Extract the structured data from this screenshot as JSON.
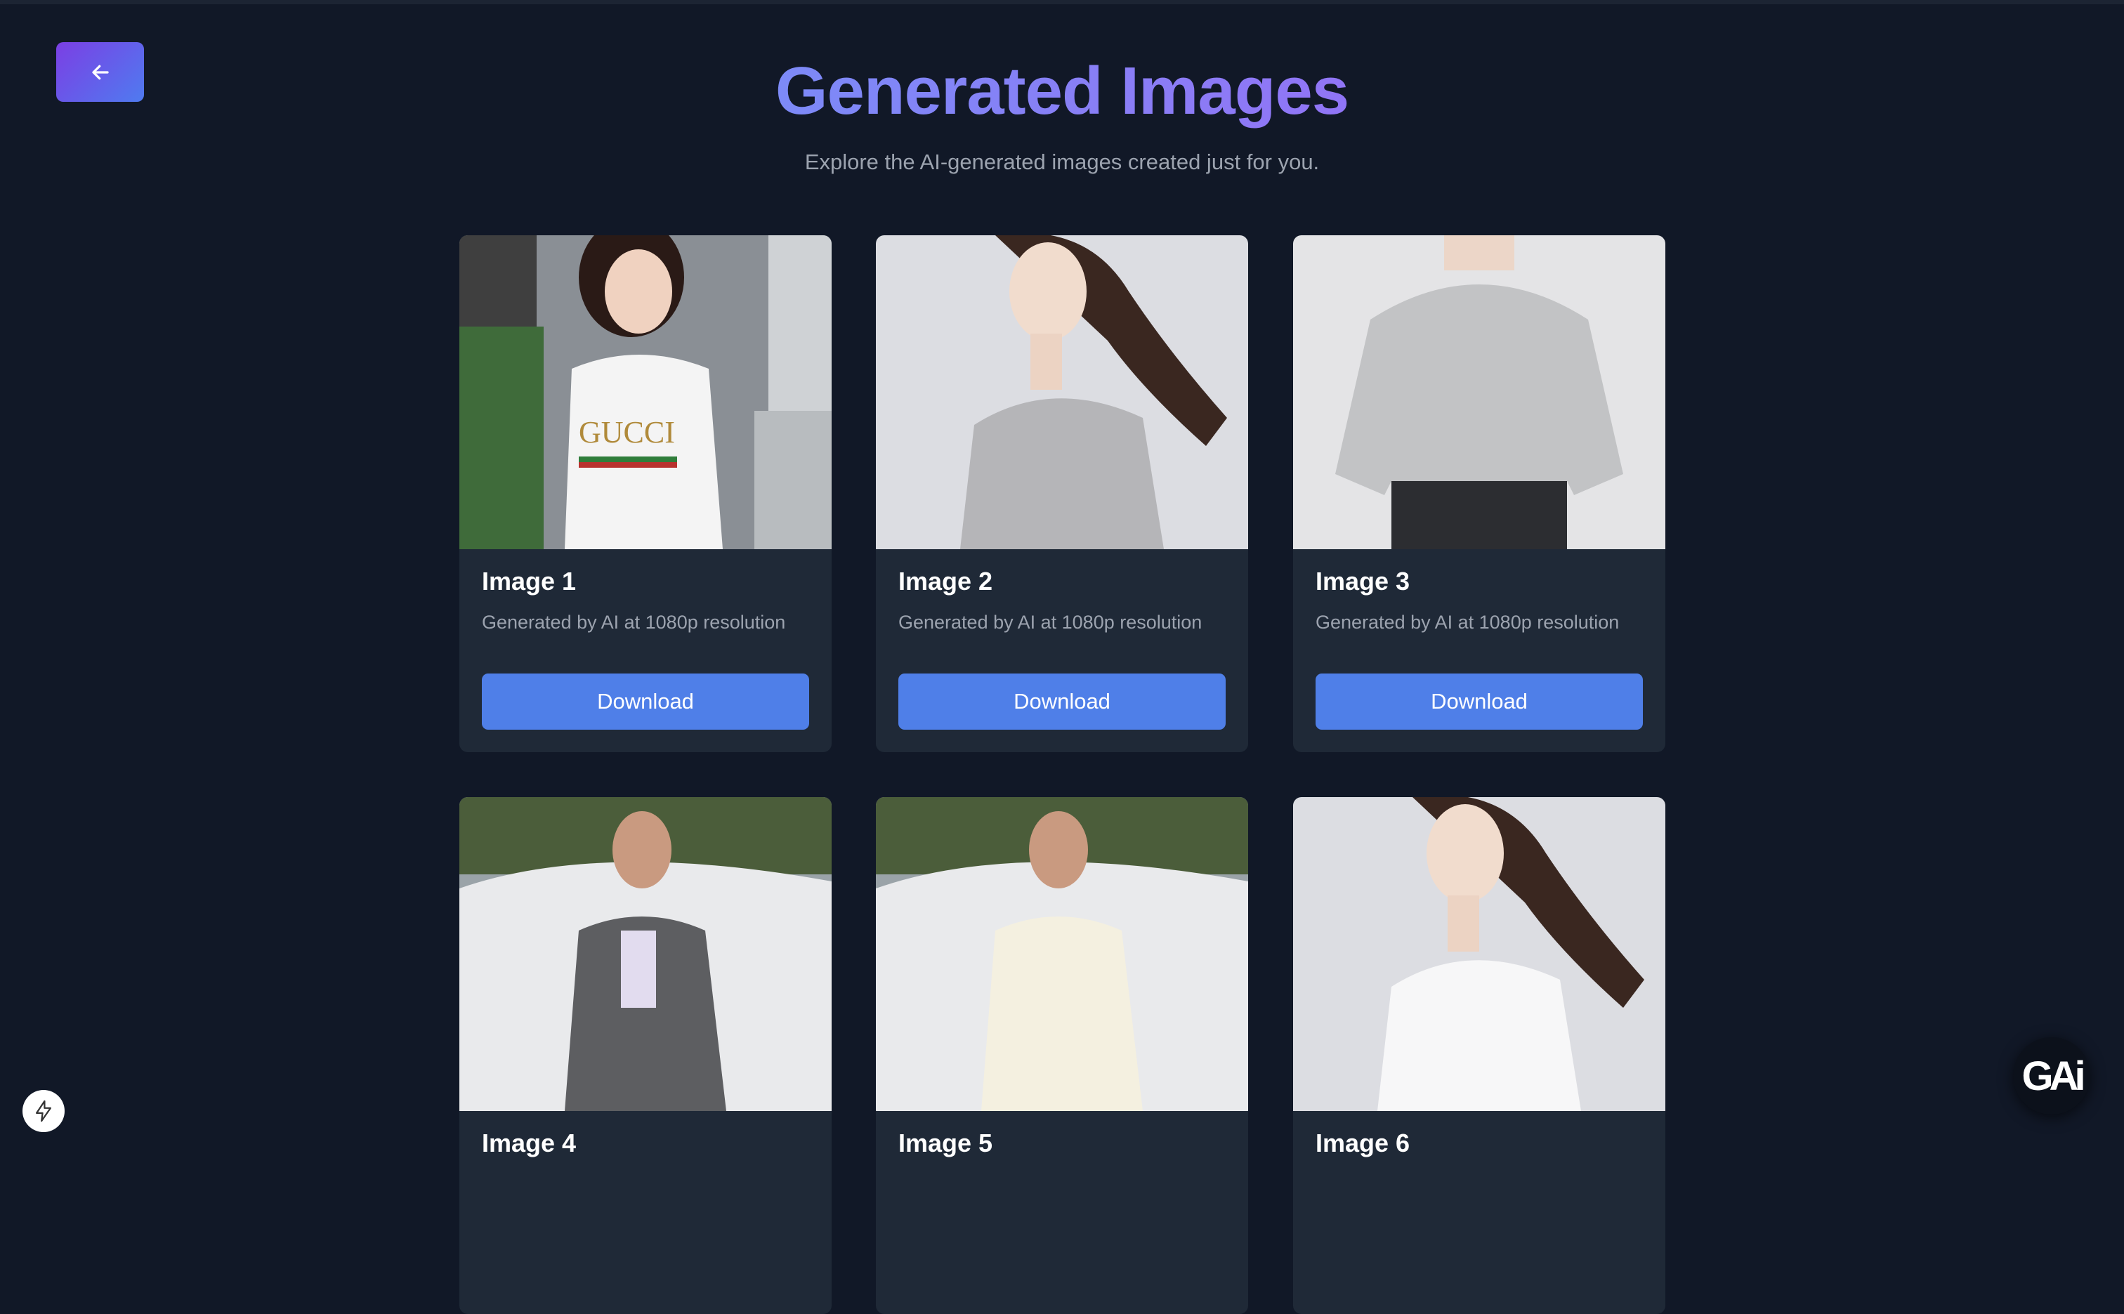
{
  "header": {
    "title": "Generated Images",
    "subtitle": "Explore the AI-generated images created just for you."
  },
  "cards": [
    {
      "title": "Image 1",
      "description": "Generated by AI at 1080p resolution",
      "button": "Download"
    },
    {
      "title": "Image 2",
      "description": "Generated by AI at 1080p resolution",
      "button": "Download"
    },
    {
      "title": "Image 3",
      "description": "Generated by AI at 1080p resolution",
      "button": "Download"
    },
    {
      "title": "Image 4",
      "description": "",
      "button": ""
    },
    {
      "title": "Image 5",
      "description": "",
      "button": ""
    },
    {
      "title": "Image 6",
      "description": "",
      "button": ""
    }
  ],
  "image1_shirt_text": "GUCCI",
  "fab": {
    "label": "GAi"
  },
  "icons": {
    "back": "arrow-left-icon",
    "bolt": "lightning-bolt-icon"
  },
  "colors": {
    "background": "#111827",
    "card": "#1f2937",
    "button": "#4f7fe8",
    "title_gradient_start": "#60a5fa",
    "title_gradient_end": "#a855f7"
  }
}
